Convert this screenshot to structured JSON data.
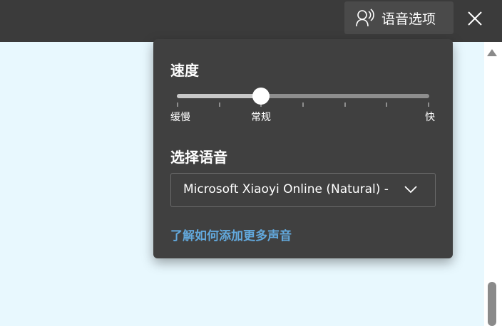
{
  "toolbar": {
    "voice_options_label": "语音选项",
    "voice_icon": "voice-speaker-icon",
    "close_icon": "close-icon"
  },
  "panel": {
    "speed_title": "速度",
    "speed_slider": {
      "min_label": "缓慢",
      "mid_label": "常规",
      "max_label": "快",
      "value_fraction": 0.333,
      "tick_count": 7
    },
    "language_title": "选择语音",
    "voice_select_value": "Microsoft Xiaoyi Online (Natural) - Chinese (Mainland)",
    "learn_more_link": "了解如何添加更多声音"
  },
  "colors": {
    "toolbar_bg": "#3b3b3b",
    "panel_bg": "#404040",
    "link": "#62a8dc",
    "page_bg": "#e8f8fe"
  }
}
